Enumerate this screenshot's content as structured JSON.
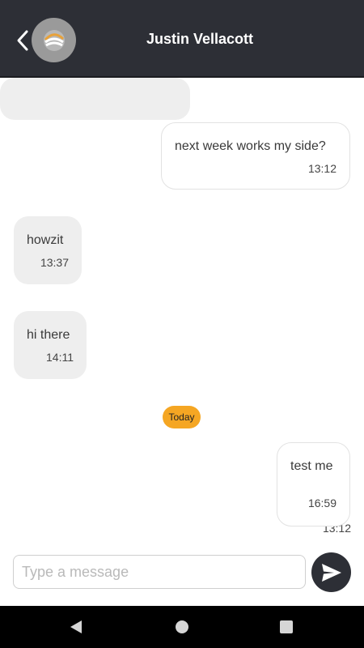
{
  "header": {
    "title": "Justin Vellacott",
    "back_icon": "chevron-left-icon",
    "avatar_icon": "company-logo-avatar"
  },
  "messages": [
    {
      "direction": "incoming",
      "text": "",
      "time": "13:12"
    },
    {
      "direction": "outgoing",
      "text": "next week works my side?",
      "time": "13:12"
    },
    {
      "direction": "incoming",
      "text": "howzit",
      "time": "13:37"
    },
    {
      "direction": "incoming",
      "text": "hi there",
      "time": "14:11"
    },
    {
      "direction": "outgoing",
      "text": "test me",
      "time": "16:59"
    }
  ],
  "date_divider": {
    "label": "Today",
    "color": "#f5a623"
  },
  "composer": {
    "placeholder": "Type a message",
    "value": "",
    "send_icon": "send-icon"
  },
  "navbar": {
    "back_icon": "nav-back-icon",
    "home_icon": "nav-home-icon",
    "recents_icon": "nav-recents-icon"
  },
  "colors": {
    "header_bg": "#2d2f36",
    "incoming_bubble": "#eeeeee",
    "outgoing_bubble": "#ffffff",
    "accent": "#f5a623"
  }
}
